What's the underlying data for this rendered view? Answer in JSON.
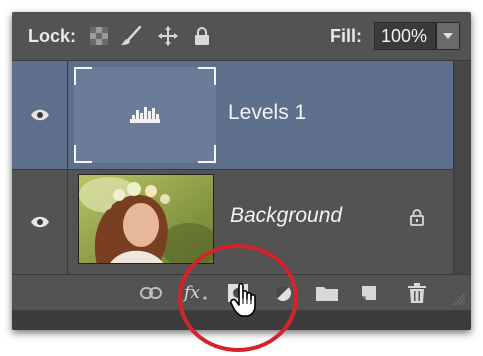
{
  "toolbar": {
    "lock_label": "Lock:",
    "fill_label": "Fill:",
    "fill_value": "100%"
  },
  "layers": [
    {
      "name": "Levels 1",
      "type": "adjustment",
      "selected": true,
      "visible": true
    },
    {
      "name": "Background",
      "type": "image",
      "selected": false,
      "visible": true,
      "locked": true
    }
  ],
  "icons": {
    "lock_transparent": "checkerboard-icon",
    "lock_image": "brush-icon",
    "lock_position": "move-icon",
    "lock_all": "padlock-icon",
    "levels": "levels-histogram-icon",
    "link": "link-icon",
    "fx": "fx-icon",
    "mask": "layer-mask-icon",
    "adjustment": "adjustment-icon",
    "group": "folder-icon",
    "new_layer": "new-layer-icon",
    "delete": "trash-icon"
  },
  "bottom_bar": {
    "fx_label": "fx"
  },
  "colors": {
    "selected_row": "#5d6f8b",
    "panel": "#535353",
    "highlight_ring": "#d4232a"
  }
}
